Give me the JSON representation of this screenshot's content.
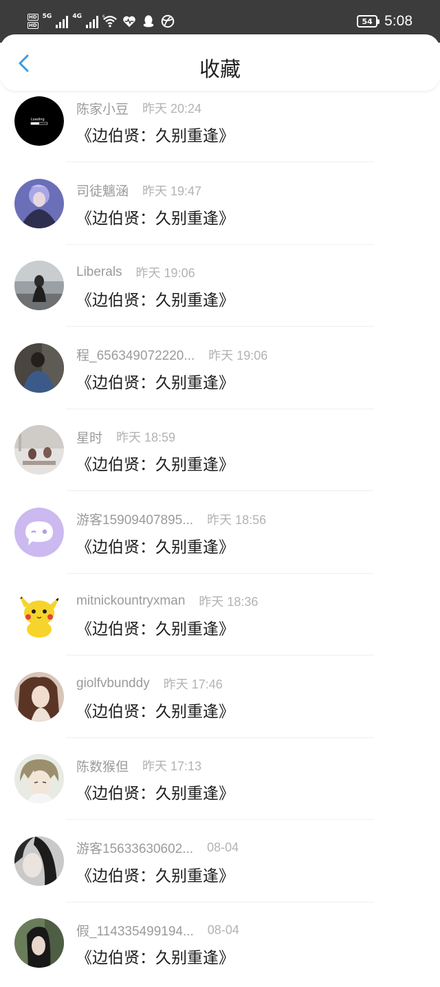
{
  "status_bar": {
    "hd1": "HD",
    "hd2": "HD",
    "net1": "5G",
    "net2": "4G",
    "wifi_sub": "6",
    "battery": "54",
    "time": "5:08"
  },
  "header": {
    "title": "收藏",
    "back_icon": "chevron-left-icon",
    "accent_color": "#3a9bdc"
  },
  "items": [
    {
      "name": "陈家小豆",
      "time": "昨天 20:24",
      "content": "《边伯贤：久别重逢》",
      "avatar": "loading-avatar"
    },
    {
      "name": "司徒魑涵",
      "time": "昨天 19:47",
      "content": "《边伯贤：久别重逢》",
      "avatar": "photo-avatar"
    },
    {
      "name": "Liberals",
      "time": "昨天 19:06",
      "content": "《边伯贤：久别重逢》",
      "avatar": "photo-avatar"
    },
    {
      "name": "程_656349072220...",
      "time": "昨天 19:06",
      "content": "《边伯贤：久别重逢》",
      "avatar": "photo-avatar"
    },
    {
      "name": "星时",
      "time": "昨天 18:59",
      "content": "《边伯贤：久别重逢》",
      "avatar": "photo-avatar"
    },
    {
      "name": "游客15909407895...",
      "time": "昨天 18:56",
      "content": "《边伯贤：久别重逢》",
      "avatar": "chat-bubble-avatar"
    },
    {
      "name": "mitnickountryxman",
      "time": "昨天 18:36",
      "content": "《边伯贤：久别重逢》",
      "avatar": "pikachu-avatar"
    },
    {
      "name": "giolfvbunddy",
      "time": "昨天 17:46",
      "content": "《边伯贤：久别重逢》",
      "avatar": "photo-avatar"
    },
    {
      "name": "陈数猴但",
      "time": "昨天 17:13",
      "content": "《边伯贤：久别重逢》",
      "avatar": "anime-avatar"
    },
    {
      "name": "游客15633630602...",
      "time": "08-04",
      "content": "《边伯贤：久别重逢》",
      "avatar": "photo-avatar"
    },
    {
      "name": "假_114335499194...",
      "time": "08-04",
      "content": "《边伯贤：久别重逢》",
      "avatar": "photo-avatar"
    }
  ]
}
